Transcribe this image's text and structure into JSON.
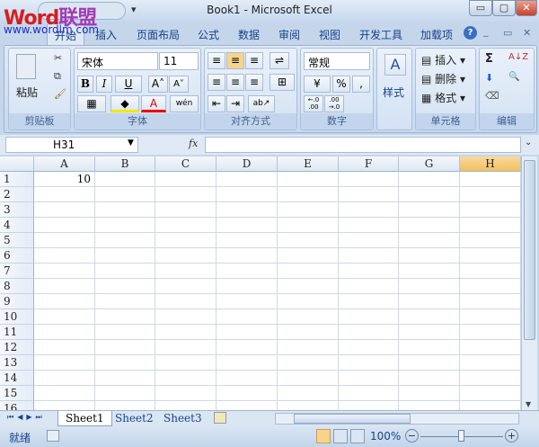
{
  "window": {
    "title": "Book1 - Microsoft Excel",
    "minimize": "▭",
    "restore": "▢",
    "close": "✕"
  },
  "watermark": {
    "logo_a": "Word",
    "logo_b": "联盟",
    "url": "www.wordlm.com"
  },
  "quick_access": {
    "customize": "▾"
  },
  "tabs": [
    {
      "label": "开始",
      "active": true
    },
    {
      "label": "插入"
    },
    {
      "label": "页面布局"
    },
    {
      "label": "公式"
    },
    {
      "label": "数据"
    },
    {
      "label": "审阅"
    },
    {
      "label": "视图"
    },
    {
      "label": "开发工具"
    },
    {
      "label": "加载项"
    }
  ],
  "ribbon_controls": {
    "help": "?",
    "minimize": "_",
    "restore": "▭",
    "close": "✕"
  },
  "clipboard": {
    "label": "剪贴板",
    "paste": "粘贴",
    "cut": "✂",
    "copy": "⧉",
    "format_painter": "🖌"
  },
  "font": {
    "label": "字体",
    "name": "宋体",
    "size": "11",
    "bold": "B",
    "italic": "I",
    "underline": "U",
    "grow": "A˄",
    "shrink": "A˅",
    "border": "▦",
    "fill": "◆",
    "color": "A",
    "phonetic": "wén"
  },
  "alignment": {
    "label": "对齐方式",
    "top": "≡",
    "middle": "≡",
    "bottom": "≡",
    "left": "≡",
    "center": "≡",
    "right": "≡",
    "wrap": "⇌",
    "merge": "⊞",
    "indent_dec": "⇤",
    "indent_inc": "⇥",
    "orientation": "ab↗"
  },
  "number": {
    "label": "数字",
    "format": "常规",
    "currency": "¥",
    "percent": "%",
    "comma": ",",
    "inc_decimal": "←.0 .00",
    "dec_decimal": ".00 →.0"
  },
  "styles": {
    "label": "样式",
    "icon": "A"
  },
  "cells": {
    "label": "单元格",
    "insert": "插入",
    "delete": "删除",
    "format": "格式"
  },
  "editing": {
    "label": "编辑",
    "sum": "Σ",
    "sort": "A↓Z",
    "fill": "⬇",
    "find": "🔍",
    "clear": "⌫"
  },
  "formula_bar": {
    "name_box": "H31",
    "fx": "fx",
    "value": ""
  },
  "columns": [
    "A",
    "B",
    "C",
    "D",
    "E",
    "F",
    "G",
    "H"
  ],
  "selected_column": "H",
  "rows": [
    "1",
    "2",
    "3",
    "4",
    "5",
    "6",
    "7",
    "8",
    "9",
    "10",
    "11",
    "12",
    "13",
    "14",
    "15",
    "16"
  ],
  "cells_data": {
    "A1": "10"
  },
  "sheets": [
    {
      "label": "Sheet1",
      "active": true
    },
    {
      "label": "Sheet2"
    },
    {
      "label": "Sheet3"
    }
  ],
  "sheet_nav": {
    "first": "⏮",
    "prev": "◀",
    "next": "▶",
    "last": "⏭"
  },
  "status": {
    "text": "就绪",
    "zoom": "100%",
    "zoom_out": "−",
    "zoom_in": "+",
    "zoom_fraction": 0.5
  }
}
